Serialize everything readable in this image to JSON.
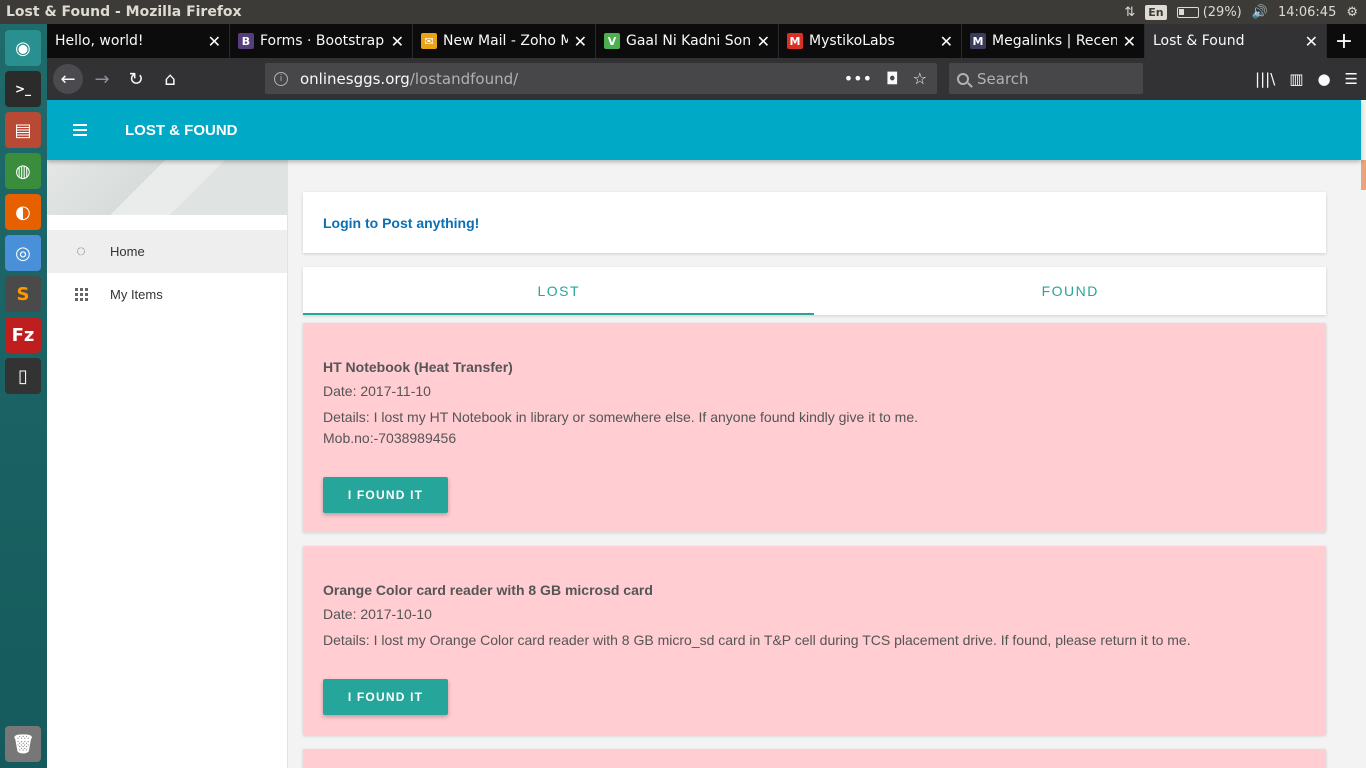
{
  "os": {
    "window_title": "Lost & Found - Mozilla Firefox",
    "lang": "En",
    "battery": "(29%)",
    "clock": "14:06:45"
  },
  "launcher": [
    {
      "name": "ubuntu-dash-icon",
      "color": "#2a8f8f"
    },
    {
      "name": "terminal-icon",
      "color": "#2b2b2b"
    },
    {
      "name": "file-manager-icon",
      "color": "#b84a35"
    },
    {
      "name": "globe-icon",
      "color": "#3b8d3e"
    },
    {
      "name": "firefox-icon",
      "color": "#e66000"
    },
    {
      "name": "chrome-icon",
      "color": "#4a90d9"
    },
    {
      "name": "sublime-text-icon",
      "color": "#4a4a4a"
    },
    {
      "name": "filezilla-icon",
      "color": "#bf1e1e"
    },
    {
      "name": "phone-icon",
      "color": "#333333"
    },
    {
      "name": "trash-icon",
      "color": "#777777"
    }
  ],
  "tabs": [
    {
      "label": "Hello, world!",
      "favicon_color": "",
      "favicon_char": ""
    },
    {
      "label": "Forms · Bootstrap",
      "favicon_color": "#563d7c",
      "favicon_char": "B"
    },
    {
      "label": "New Mail - Zoho M",
      "favicon_color": "#e8a317",
      "favicon_char": "✉"
    },
    {
      "label": "Gaal Ni Kadni Song",
      "favicon_color": "#4caf50",
      "favicon_char": "V"
    },
    {
      "label": "MystikoLabs",
      "favicon_color": "#d93025",
      "favicon_char": "M"
    },
    {
      "label": "Megalinks | Recent",
      "favicon_color": "#3a3a5a",
      "favicon_char": "M"
    },
    {
      "label": "Lost & Found",
      "favicon_color": "",
      "favicon_char": ""
    }
  ],
  "url": {
    "host": "onlinesggs.org",
    "path": "/lostandfound/",
    "search_placeholder": "Search"
  },
  "app": {
    "title": "LOST & FOUND"
  },
  "drawer": {
    "items": [
      {
        "label": "Home"
      },
      {
        "label": "My Items"
      }
    ]
  },
  "main": {
    "login_prompt": "Login to Post anything!",
    "tabs": [
      "LOST",
      "FOUND"
    ],
    "items": [
      {
        "title": "HT Notebook (Heat Transfer)",
        "date": "Date: 2017-11-10",
        "details": "Details: I lost my HT Notebook in library or somewhere else. If anyone found kindly give it to me.",
        "extra": "Mob.no:-7038989456",
        "button": "I FOUND IT"
      },
      {
        "title": "Orange Color card reader with 8 GB microsd card",
        "date": "Date: 2017-10-10",
        "details": "Details: I lost my Orange Color card reader with 8 GB micro_sd card in T&P cell during TCS placement drive. If found, please return it to me.",
        "extra": "",
        "button": "I FOUND IT"
      }
    ]
  },
  "colors": {
    "appbar": "#00a9c5",
    "accent": "#26a69a",
    "card_pink": "#ffcdd2",
    "link": "#0a6fb5"
  }
}
